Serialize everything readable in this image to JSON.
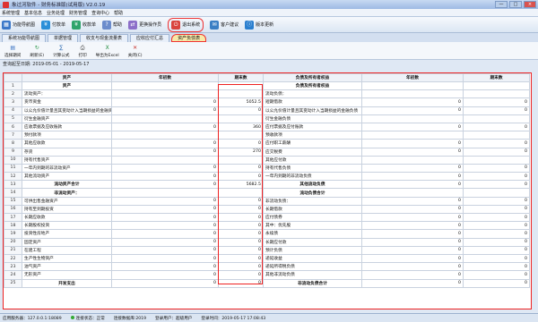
{
  "window": {
    "title": "象过河软件 - 财务标准版(试用版) V2.0.19",
    "min": "—",
    "max": "□",
    "close": "×"
  },
  "menu": [
    "系统管理",
    "基本信息",
    "业务处理",
    "财务管理",
    "查询中心",
    "帮助"
  ],
  "toolbar": [
    {
      "label": "功能导航图",
      "icon": "grid-icon",
      "color": "#3b78c9",
      "glyph": "▦"
    },
    {
      "label": "付款单",
      "icon": "payment-icon",
      "color": "#2a8fd8",
      "glyph": "¥"
    },
    {
      "label": "收款单",
      "icon": "receipt-icon",
      "color": "#2ea46b",
      "glyph": "¥"
    },
    {
      "label": "帮助",
      "icon": "help-icon",
      "color": "#6b8ccc",
      "glyph": "?"
    },
    {
      "label": "更换操作员",
      "icon": "user-switch-icon",
      "color": "#8c6fc9",
      "glyph": "⇄"
    },
    {
      "label": "退出系统",
      "icon": "exit-icon",
      "color": "#d9443e",
      "glyph": "⏻"
    },
    {
      "label": "客户建议",
      "icon": "feedback-icon",
      "color": "#3a7fc4",
      "glyph": "✉"
    },
    {
      "label": "版本更新",
      "icon": "update-icon",
      "color": "#2a7fcf",
      "glyph": "ⓘ"
    }
  ],
  "tabs": [
    "系统功能导航图",
    "单据管理",
    "收支与现金流量表",
    "应收应付汇总",
    "资产负债表"
  ],
  "subtoolbar": [
    {
      "label": "选择期间",
      "icon": "calendar-icon",
      "glyph": "▤",
      "color": "#3973c2"
    },
    {
      "label": "刷新(E)",
      "icon": "refresh-icon",
      "glyph": "↻",
      "color": "#2e9a4c"
    },
    {
      "label": "计算公式",
      "icon": "formula-icon",
      "glyph": "∑",
      "color": "#2f6db3"
    },
    {
      "label": "打印",
      "icon": "printer-icon",
      "glyph": "⎙",
      "color": "#444"
    },
    {
      "label": "导出为Excel",
      "icon": "excel-icon",
      "glyph": "X",
      "color": "#1f8a3c"
    },
    {
      "label": "关闭(C)",
      "icon": "close-icon",
      "glyph": "✕",
      "color": "#c7302a"
    }
  ],
  "period": "查询起至日期: 2019-05-01 - 2019-05-17",
  "headers": [
    "",
    "资产",
    "年初数",
    "期末数",
    "负债及所有者权益",
    "年初数",
    "期末数"
  ],
  "rows": [
    [
      "1",
      "资产",
      "",
      "",
      "负债及所有者权益",
      "",
      ""
    ],
    [
      "2",
      "流动资产：",
      "",
      "",
      "流动负债：",
      "",
      ""
    ],
    [
      "3",
      "货币资金",
      "0",
      "5052.5",
      "短期借款",
      "0",
      "0"
    ],
    [
      "4",
      "以公允价值计量且其变动计入当期损益的金融资产",
      "0",
      "0",
      "以公允价值计量且其变动计入当期损益的金融负债",
      "0",
      "0"
    ],
    [
      "5",
      "衍生金融资产",
      "",
      "",
      "衍生金融负债",
      "",
      ""
    ],
    [
      "6",
      "应收票据及应收账款",
      "0",
      "360",
      "应付票据及应付账款",
      "0",
      "0"
    ],
    [
      "7",
      "预付款项",
      "",
      "",
      "预收款项",
      "",
      ""
    ],
    [
      "8",
      "其他应收款",
      "0",
      "0",
      "应付职工薪酬",
      "0",
      "0"
    ],
    [
      "9",
      "存货",
      "0",
      "270",
      "应交税费",
      "0",
      "0"
    ],
    [
      "10",
      "持有代售资产",
      "",
      "",
      "其他应付款",
      "",
      ""
    ],
    [
      "11",
      "一年内到期的非流动资产",
      "0",
      "0",
      "持有代售负债",
      "0",
      "0"
    ],
    [
      "12",
      "其他流动资产",
      "0",
      "0",
      "一年内到期的非流动负债",
      "0",
      "0"
    ],
    [
      "13",
      "流动资产合计",
      "0",
      "5682.5",
      "其他流动负债",
      "0",
      "0"
    ],
    [
      "14",
      "非流动资产：",
      "",
      "",
      "流动负债合计",
      "",
      ""
    ],
    [
      "15",
      "可供出售金融资产",
      "0",
      "0",
      "非流动负债：",
      "0",
      "0"
    ],
    [
      "16",
      "持有至到期投资",
      "0",
      "0",
      "长期借款",
      "0",
      "0"
    ],
    [
      "17",
      "长期应收款",
      "0",
      "0",
      "应付债券",
      "0",
      "0"
    ],
    [
      "18",
      "长期股权投资",
      "0",
      "0",
      "其中：优先股",
      "0",
      "0"
    ],
    [
      "19",
      "投资性房地产",
      "0",
      "0",
      "永续债",
      "0",
      "0"
    ],
    [
      "20",
      "固定资产",
      "0",
      "0",
      "长期应付款",
      "0",
      "0"
    ],
    [
      "21",
      "在建工程",
      "0",
      "0",
      "预计负债",
      "0",
      "0"
    ],
    [
      "22",
      "生产性生物资产",
      "0",
      "0",
      "递延收益",
      "0",
      "0"
    ],
    [
      "23",
      "油气资产",
      "0",
      "0",
      "递延所得税负债",
      "0",
      "0"
    ],
    [
      "24",
      "无形资产",
      "0",
      "0",
      "其他非流动负债",
      "0",
      "0"
    ],
    [
      "25",
      "开发支出",
      "0",
      "0",
      "非流动负债合计",
      "0",
      "0"
    ]
  ],
  "status": {
    "server": "应用服务器：127.0.0.1:18089",
    "conn": "连接状态：正常",
    "db": "连接数据库:2019",
    "user": "登录用户：超级用户",
    "time": "登录时间：2019-05-17 17:08:43"
  }
}
